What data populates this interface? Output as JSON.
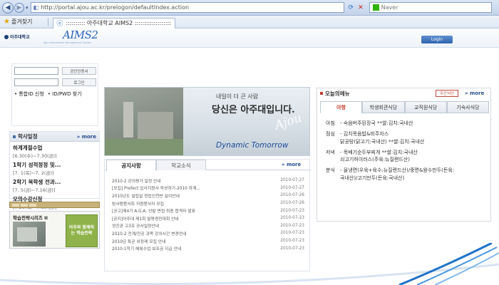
{
  "browser": {
    "address_url": "http://portal.ajou.ac.kr/prelogon/defaultIndex.action",
    "search_placeholder": "Naver",
    "favorites_label": "즐겨찾기",
    "tab_title": ":::::::::: 아주대학교 AIMS2 :::::::::::::::::::"
  },
  "header": {
    "university_logo": "아주대학교",
    "aims_title": "AIMS2",
    "aims_subtitle": "Ajou Information Management System",
    "login_button": "Login"
  },
  "login_box": {
    "cert_button": "공인인증서",
    "login_button": "로그인",
    "links": [
      "• 통합ID 신청",
      "• ID/PWD 찾기"
    ]
  },
  "schedule": {
    "title": "학사일정",
    "more": "» more",
    "items": [
      {
        "name": "하계계절수업",
        "date": "[6.30(수)~7.30(금)]"
      },
      {
        "name": "1학기 성적정정 및...",
        "date": "[7. 1(목)~7. 2(금)]"
      },
      {
        "name": "2학기 복학생 전과...",
        "date": "[7. 5(금)~7.16(금)]"
      },
      {
        "name": "모의수강신청",
        "date": "[7.29(목)~7.30(금)]"
      }
    ]
  },
  "study_box": {
    "title": "학습전략시리즈 II",
    "green_text": "아주와 함께하는 학습전략"
  },
  "hero": {
    "line1": "내일이 더 큰 사람",
    "line2": "당신은 아주대입니다.",
    "ajou_script": "Ajou",
    "dynamic": "Dynamic Tomorrow"
  },
  "notice": {
    "tabs": [
      "공지사항",
      "학교소식"
    ],
    "more": "» more",
    "rows": [
      {
        "title": "2010-2 강의평가 일정 안내",
        "date": "2010-07-27"
      },
      {
        "title": "[모집] Prefect 입사지원서 작성하기-2010 하계...",
        "date": "2010-07-27"
      },
      {
        "title": "2010년도 설립설 정립인천반 살이안내",
        "date": "2010-07-26"
      },
      {
        "title": "탐사팬봉사회 저원봉사자 모집",
        "date": "2010-07-26"
      },
      {
        "title": "[공고]제4기 A.G.A. 선발 면접 최종 합격자 발표",
        "date": "2010-07-23"
      },
      {
        "title": "[공지]아주대 제1회 발명경진대회 안내",
        "date": "2010-07-23"
      },
      {
        "title": "정진관 고3호 공사일정안내",
        "date": "2010-07-23"
      },
      {
        "title": "2010-2 전계/전공 과목 강의시간 변경안내",
        "date": "2010-07-23"
      },
      {
        "title": "2010년 특균 외장례 모집 안내",
        "date": "2010-07-23"
      },
      {
        "title": "2010-1학기 해복수업 보조금 지급 안내",
        "date": "2010-07-23"
      }
    ]
  },
  "menu": {
    "title": "오늘의메뉴",
    "weekly": "주간식단",
    "more": "» more",
    "tabs": [
      "아항",
      "학생회관식당",
      "교직원식당",
      "기숙사식당"
    ],
    "meals": [
      {
        "meal": "아침",
        "dishes": [
          "- 숙음버주된장국 **쌀:김치:국내산"
        ]
      },
      {
        "meal": "점심",
        "dishes": [
          "- 김치목음밥&비주자스",
          "  닭공탕(닭고기:국내산) **쌀:김치:국내산"
        ]
      },
      {
        "meal": "저녁",
        "dishes": [
          "- 목배기순두부찌개 **쌀:김치:국내산",
          "  쇠고기허이러스(주육:뉴질랜드산)"
        ]
      },
      {
        "meal": "분식",
        "dishes": [
          "- 울냉면(우육+육수:뉴질랜드산)/중면&왕수만두(돈육:",
          "  국내산)/고기만두(돈육:국내산)"
        ]
      }
    ]
  }
}
